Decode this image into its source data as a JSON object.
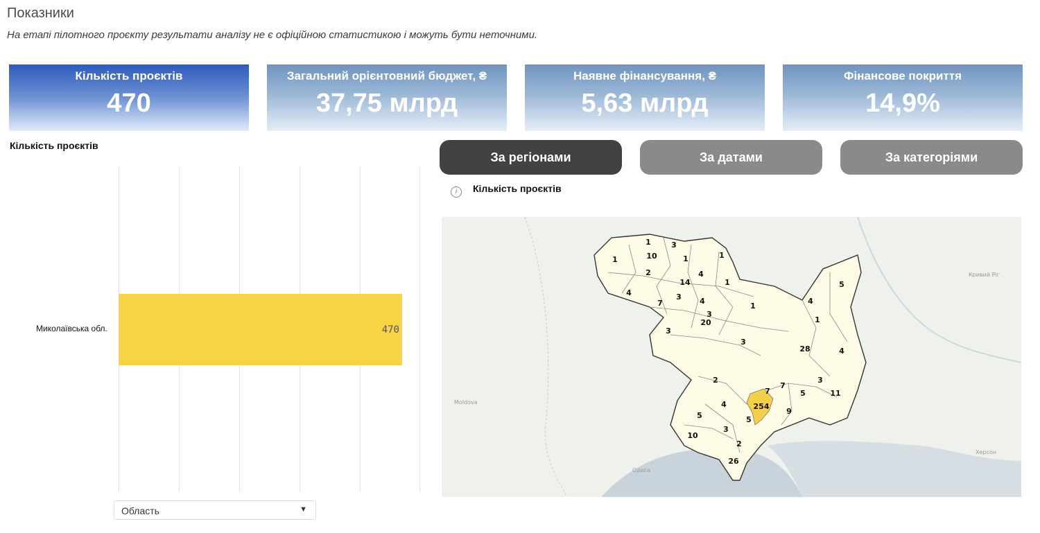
{
  "header": {
    "title": "Показники",
    "subtitle": "На етапі пілотного проєкту результати аналізу не є офіційною статистикою і можуть бути неточними."
  },
  "kpis": [
    {
      "label": "Кількість проєктів",
      "value": "470"
    },
    {
      "label": "Загальний орієнтовний бюджет, ₴",
      "value": "37,75 млрд"
    },
    {
      "label": "Наявне фінансування, ₴",
      "value": "5,63 млрд"
    },
    {
      "label": "Фінансове покриття",
      "value": "14,9%"
    }
  ],
  "left_chart": {
    "title": "Кількість проєктів",
    "dropdown_value": "Область",
    "accent": "#f7d444"
  },
  "chart_data": {
    "type": "bar",
    "orientation": "horizontal",
    "title": "Кількість проєктів",
    "categories": [
      "Миколаївська обл."
    ],
    "values": [
      470
    ],
    "xlim": [
      0,
      500
    ],
    "grid": true
  },
  "tabs": [
    "За регіонами",
    "За датами",
    "За категоріями"
  ],
  "active_tab": 0,
  "map": {
    "title": "Кількість проєктів",
    "info_icon": "info-icon",
    "fill_color": "#fdfbe5",
    "highlight_color": "#f4cf4a",
    "regions": [
      {
        "count": "1"
      },
      {
        "count": "3"
      },
      {
        "count": "1"
      },
      {
        "count": "10"
      },
      {
        "count": "1"
      },
      {
        "count": "1"
      },
      {
        "count": "2"
      },
      {
        "count": "4"
      },
      {
        "count": "14"
      },
      {
        "count": "1"
      },
      {
        "count": "4"
      },
      {
        "count": "7"
      },
      {
        "count": "3"
      },
      {
        "count": "4"
      },
      {
        "count": "3"
      },
      {
        "count": "20"
      },
      {
        "count": "1"
      },
      {
        "count": "3"
      },
      {
        "count": "3"
      },
      {
        "count": "5"
      },
      {
        "count": "4"
      },
      {
        "count": "1"
      },
      {
        "count": "28"
      },
      {
        "count": "4"
      },
      {
        "count": "2"
      },
      {
        "count": "7"
      },
      {
        "count": "7"
      },
      {
        "count": "3"
      },
      {
        "count": "5"
      },
      {
        "count": "11"
      },
      {
        "count": "254"
      },
      {
        "count": "4"
      },
      {
        "count": "5"
      },
      {
        "count": "9"
      },
      {
        "count": "5"
      },
      {
        "count": "10"
      },
      {
        "count": "3"
      },
      {
        "count": "2"
      },
      {
        "count": "26"
      }
    ],
    "places": [
      "Кривий Ріг",
      "Херсон",
      "Одеса",
      "Moldova"
    ]
  }
}
